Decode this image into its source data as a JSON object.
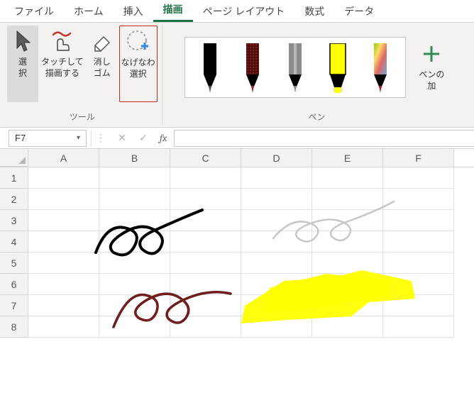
{
  "tabs": {
    "file": "ファイル",
    "home": "ホーム",
    "insert": "挿入",
    "draw": "描画",
    "pagelayout": "ページ レイアウト",
    "formulas": "数式",
    "data": "データ"
  },
  "ribbon": {
    "tools_group_label": "ツール",
    "pen_group_label": "ペン",
    "select": {
      "label": "選\n択"
    },
    "touch_draw": {
      "label": "タッチして\n描画する"
    },
    "eraser": {
      "label": "消し\nゴム"
    },
    "lasso": {
      "label": "なげなわ\n選択"
    },
    "pen_add": {
      "label": "ペンの\n加"
    }
  },
  "namebox": {
    "value": "F7"
  },
  "columns": [
    "A",
    "B",
    "C",
    "D",
    "E",
    "F"
  ],
  "rows": [
    "1",
    "2",
    "3",
    "4",
    "5",
    "6",
    "7",
    "8"
  ]
}
